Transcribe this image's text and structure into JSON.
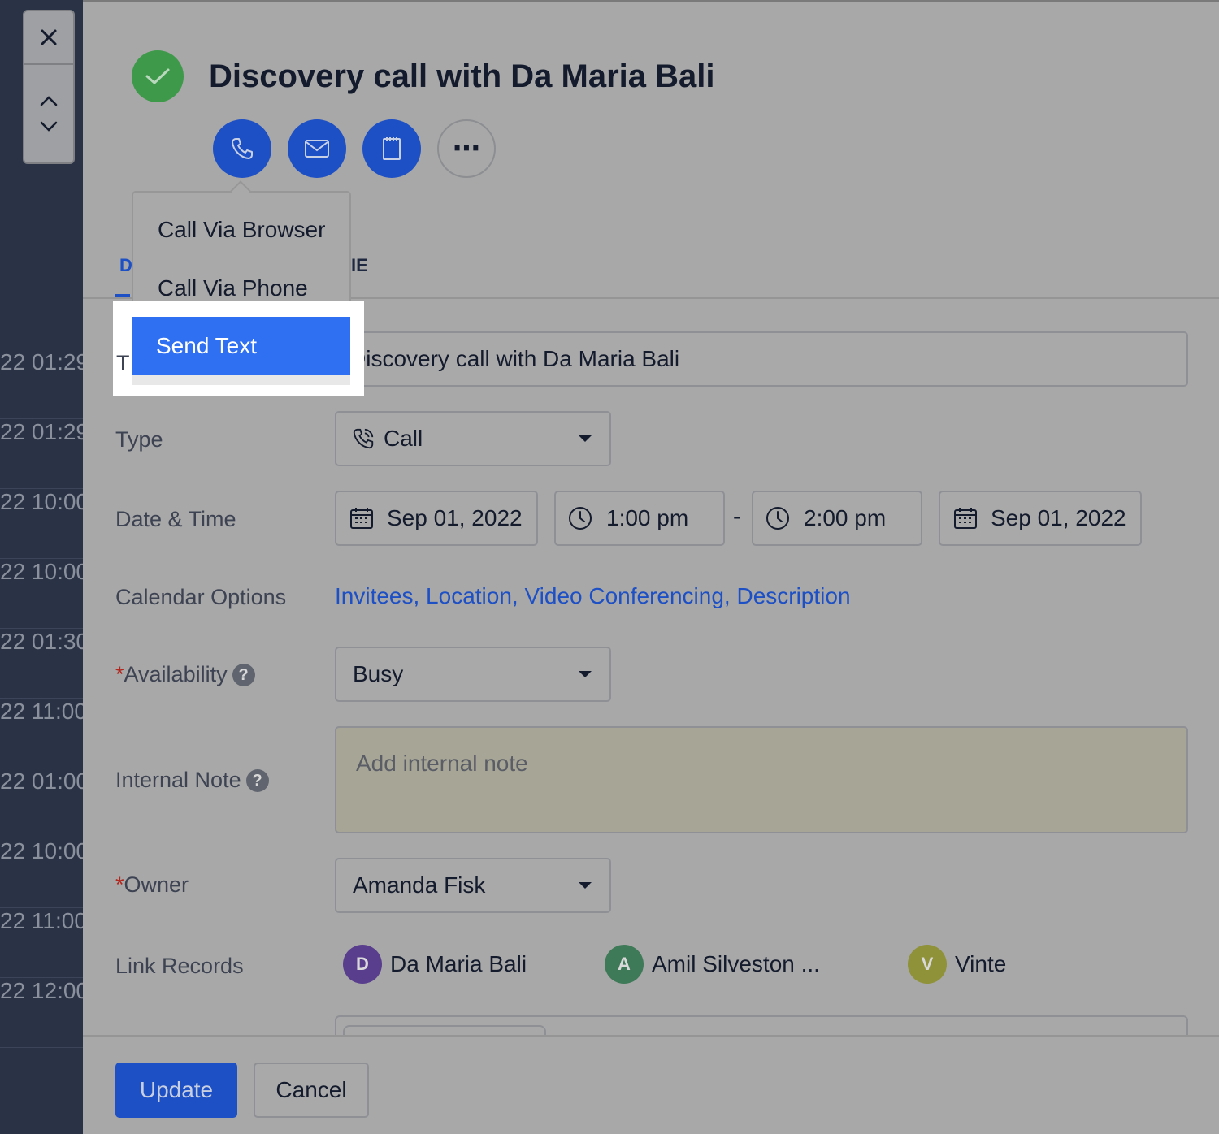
{
  "background_rows": [
    "22 01:29",
    "22 01:29",
    "22 10:00",
    "22 10:00",
    "22 01:30",
    "22 11:00",
    "22 01:00",
    "22 10:00",
    "22 11:00",
    "22 12:00"
  ],
  "nav": {
    "close": "×"
  },
  "header": {
    "title": "Discovery call with Da Maria Bali"
  },
  "actions": {
    "more_label": "⋯"
  },
  "tabs": {
    "first_partial": "D",
    "second_partial": "IE"
  },
  "call_menu": {
    "items": [
      "Call Via Browser",
      "Call Via Phone"
    ],
    "selected": "Send Text"
  },
  "form": {
    "title_label_partial": "T",
    "title_value": "Discovery call with Da Maria Bali",
    "type_label": "Type",
    "type_value": "Call",
    "datetime_label": "Date & Time",
    "start_date": "Sep 01, 2022",
    "start_time": "1:00 pm",
    "time_separator": "-",
    "end_time": "2:00 pm",
    "end_date": "Sep 01, 2022",
    "calendar_label": "Calendar Options",
    "calendar_links": "Invitees, Location, Video Conferencing, Description",
    "required_mark": "*",
    "availability_label": "Availability",
    "availability_value": "Busy",
    "help_mark": "?",
    "note_label": "Internal Note",
    "note_placeholder": "Add internal note",
    "owner_label": "Owner",
    "owner_value": "Amanda Fisk",
    "link_label": "Link Records",
    "records": [
      {
        "initial": "D",
        "name": "Da Maria Bali",
        "color": "#5a3e8e"
      },
      {
        "initial": "A",
        "name": "Amil Silveston ...",
        "color": "#3f7a58"
      },
      {
        "initial": "V",
        "name": "Vinte",
        "color": "#8f9238"
      }
    ]
  },
  "footer": {
    "update": "Update",
    "cancel": "Cancel"
  },
  "colors": {
    "primary": "#1d4fc5",
    "highlight": "#2f6ff2",
    "success": "#3e9a4a"
  }
}
